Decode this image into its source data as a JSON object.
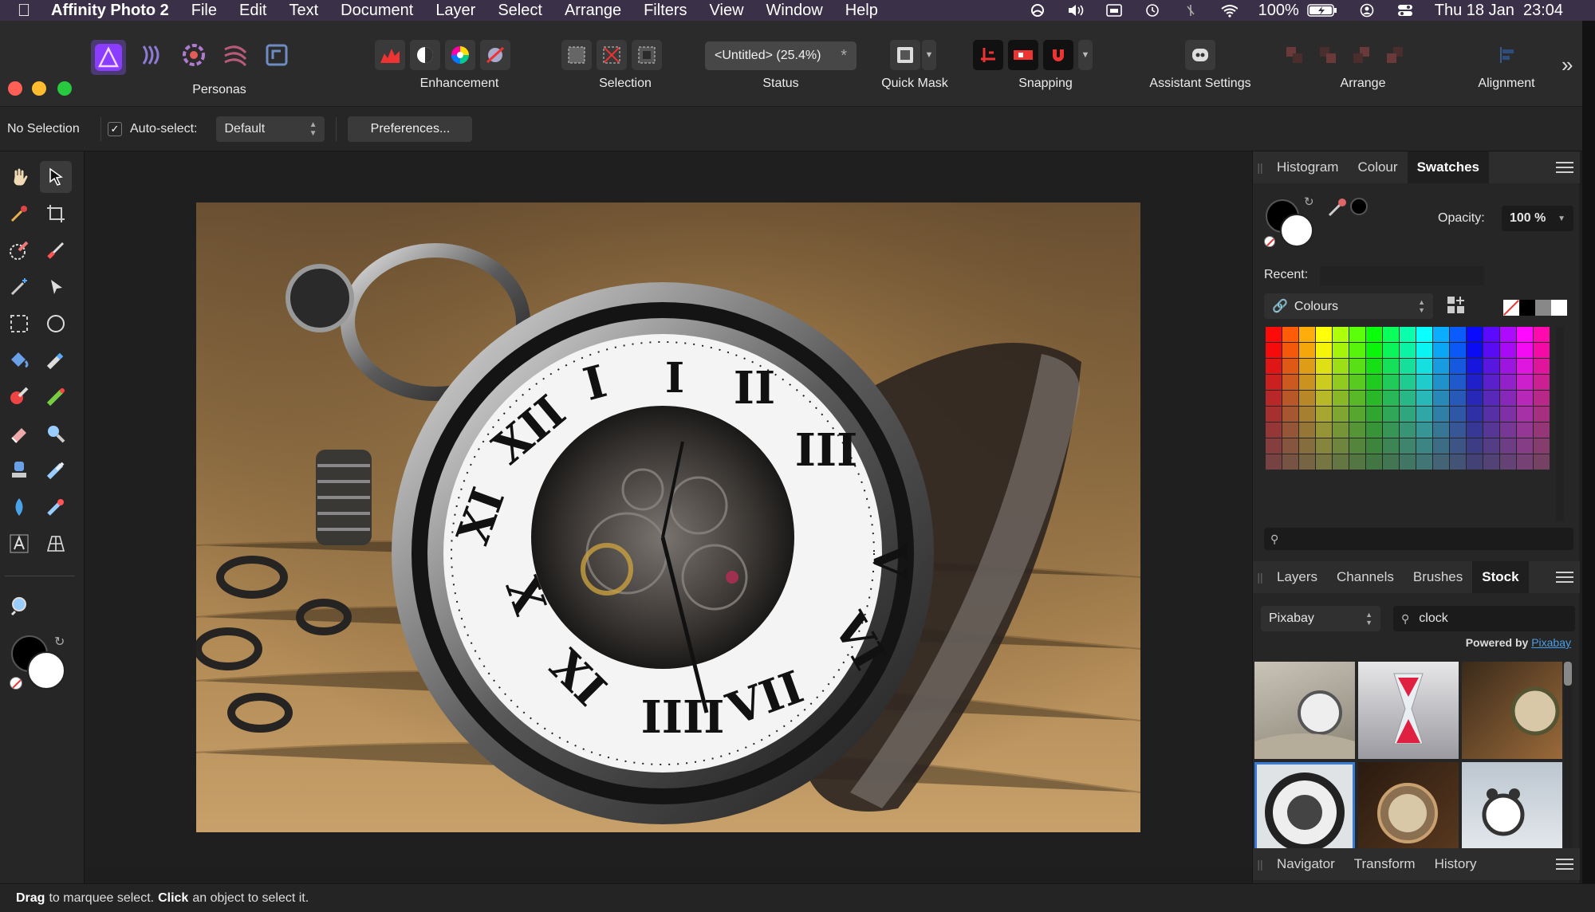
{
  "menubar": {
    "app_name": "Affinity Photo 2",
    "items": [
      "File",
      "Edit",
      "Text",
      "Document",
      "Layer",
      "Select",
      "Arrange",
      "Filters",
      "View",
      "Window",
      "Help"
    ],
    "battery": "100%",
    "clock": "Thu 18 Jan  23:04"
  },
  "toolbar": {
    "personas_label": "Personas",
    "enhancement_label": "Enhancement",
    "selection_label": "Selection",
    "status_label": "Status",
    "document_status": "<Untitled> (25.4%)",
    "document_status_mark": "*",
    "quick_mask_label": "Quick Mask",
    "snapping_label": "Snapping",
    "assistant_label": "Assistant Settings",
    "arrange_label": "Arrange",
    "alignment_label": "Alignment",
    "overflow_glyph": "»"
  },
  "context": {
    "selection_state": "No Selection",
    "autoselect_label": "Auto-select:",
    "autoselect_value": "Default",
    "preferences_label": "Preferences..."
  },
  "swatches_panel": {
    "tabs": [
      "Histogram",
      "Colour",
      "Swatches"
    ],
    "opacity_label": "Opacity:",
    "opacity_value": "100 %",
    "recent_label": "Recent:",
    "palette_name": "Colours"
  },
  "stock_panel": {
    "tabs": [
      "Layers",
      "Channels",
      "Brushes",
      "Stock"
    ],
    "provider": "Pixabay",
    "search_value": "clock",
    "powered_prefix": "Powered by",
    "powered_link": "Pixabay"
  },
  "bottom_panel": {
    "tabs": [
      "Navigator",
      "Transform",
      "History"
    ]
  },
  "status": {
    "drag_bold": "Drag",
    "drag_text": "to marquee select.",
    "click_bold": "Click",
    "click_text": "an object to select it."
  },
  "colors": {
    "menubar": "#3a3048",
    "panel": "#262626",
    "accent": "#3a7bd5",
    "affinity_purple": "#9b4dff"
  },
  "icons": {
    "apple": "apple-logo-icon",
    "tools": [
      "hand-icon",
      "move-icon",
      "color-picker-icon",
      "crop-icon",
      "selection-brush-icon",
      "paint-brush-icon",
      "magic-wand-icon",
      "node-icon",
      "marquee-icon",
      "ellipse-icon",
      "flood-fill-icon",
      "erase-brush-icon",
      "dodge-icon",
      "healing-icon",
      "eraser-icon",
      "zoom-icon",
      "clone-icon",
      "smudge-icon",
      "blur-icon",
      "red-eye-icon",
      "text-icon",
      "mesh-warp-icon"
    ]
  }
}
